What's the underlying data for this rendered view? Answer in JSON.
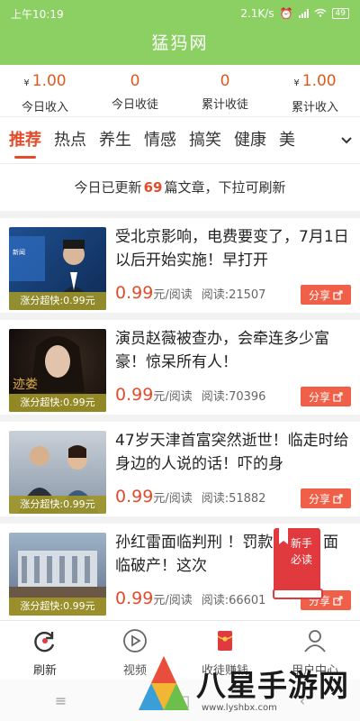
{
  "status_bar": {
    "time": "上午10:19",
    "speed": "2.1K/s",
    "battery": "49"
  },
  "app": {
    "title": "猛犸网"
  },
  "stats": [
    {
      "value": "1.00",
      "currency": "¥",
      "label": "今日收入"
    },
    {
      "value": "0",
      "currency": "",
      "label": "今日收徒"
    },
    {
      "value": "0",
      "currency": "",
      "label": "累计收徒"
    },
    {
      "value": "1.00",
      "currency": "¥",
      "label": "累计收入"
    }
  ],
  "tabs": [
    "推荐",
    "热点",
    "养生",
    "情感",
    "搞笑",
    "健康",
    "美"
  ],
  "notice": {
    "prefix": "今日已更新",
    "count": "69",
    "suffix": "篇文章，下拉可刷新"
  },
  "articles": [
    {
      "title": "受北京影响，电费要变了，7月1日以后开始实施！早打开",
      "price": "0.99",
      "unit": "元/阅读",
      "reads": "阅读:21507",
      "badge": "涨分超快:0.99元",
      "share": "分享"
    },
    {
      "title": "演员赵薇被查办，会牵连多少富豪！惊呆所有人！",
      "price": "0.99",
      "unit": "元/阅读",
      "reads": "阅读:70396",
      "badge": "涨分超快:0.99元",
      "share": "分享"
    },
    {
      "title": "47岁天津首富突然逝世！临走时给身边的人说的话！吓的身",
      "price": "0.99",
      "unit": "元/阅读",
      "reads": "阅读:51882",
      "badge": "涨分超快:0.99元",
      "share": "分享"
    },
    {
      "title": "孙红雷面临判刑 ！罚款99亿，面临破产！这次",
      "price": "0.99",
      "unit": "元/阅读",
      "reads": "阅读:66601",
      "badge": "涨分超快:0.99元",
      "share": "分享"
    }
  ],
  "bookmark": {
    "line1": "新手",
    "line2": "必读"
  },
  "bottom_nav": [
    {
      "label": "刷新",
      "icon": "refresh-icon"
    },
    {
      "label": "视频",
      "icon": "play-icon"
    },
    {
      "label": "收徒赚钱",
      "icon": "red-envelope-icon"
    },
    {
      "label": "用户中心",
      "icon": "user-icon"
    }
  ],
  "watermark": {
    "text": "八星手游网",
    "url": "www.lyshbx.com"
  }
}
